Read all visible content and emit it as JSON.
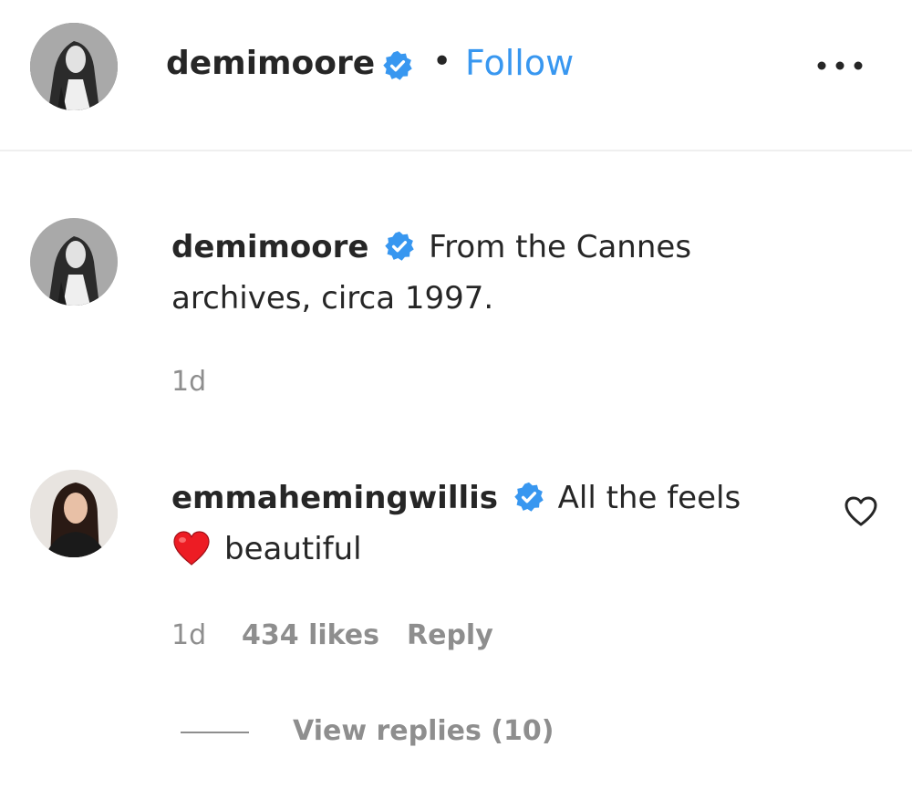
{
  "header": {
    "username": "demimoore",
    "separator": "•",
    "follow_label": "Follow",
    "verified_icon": "verified-badge-icon",
    "more_icon": "more-options-icon"
  },
  "caption": {
    "username": "demimoore",
    "text": "From the Cannes archives, circa 1997.",
    "time": "1d"
  },
  "comment": {
    "username": "emmahemingwillis",
    "text_before": "All the feels",
    "emoji": "red-heart-icon",
    "text_after": "beautiful",
    "time": "1d",
    "likes": "434 likes",
    "reply_label": "Reply",
    "view_replies": "View replies (10)"
  },
  "colors": {
    "accent": "#3897f0",
    "text": "#262626",
    "muted": "#8e8e8e",
    "heart": "#ed1c24"
  }
}
